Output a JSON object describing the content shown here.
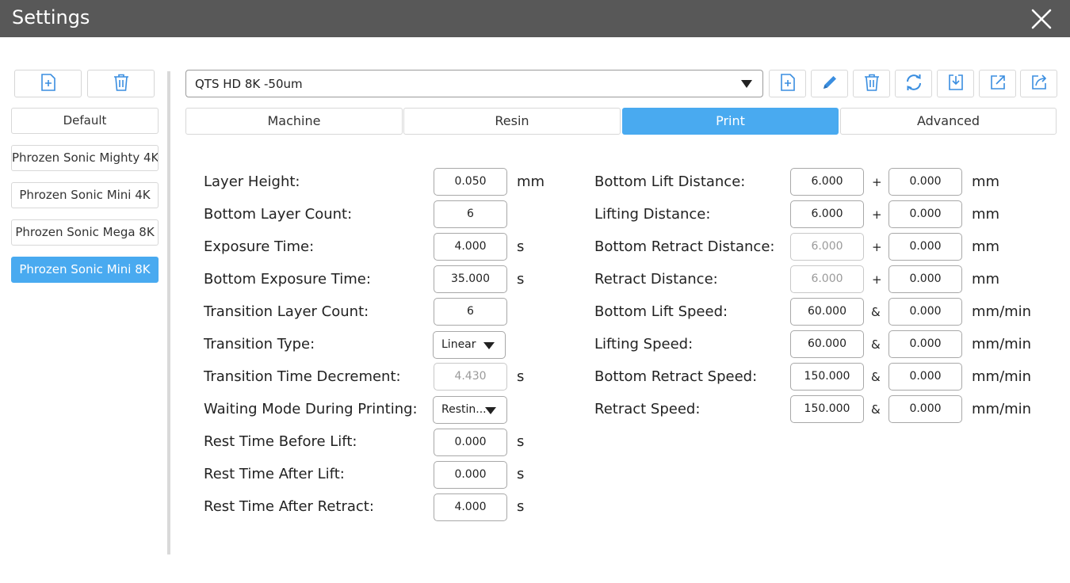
{
  "window": {
    "title": "Settings"
  },
  "colors": {
    "accent": "#49aaf0",
    "titlebar": "#585858",
    "icon": "#3a8ee0"
  },
  "profiles": {
    "items": [
      {
        "label": "Default"
      },
      {
        "label": "Phrozen Sonic Mighty 4K"
      },
      {
        "label": "Phrozen Sonic Mini 4K"
      },
      {
        "label": "Phrozen Sonic Mega 8K"
      },
      {
        "label": "Phrozen Sonic Mini 8K"
      }
    ],
    "selected": "Phrozen Sonic Mini 8K"
  },
  "preset": {
    "value": "QTS HD 8K -50um"
  },
  "tabs": [
    {
      "label": "Machine"
    },
    {
      "label": "Resin"
    },
    {
      "label": "Print"
    },
    {
      "label": "Advanced"
    }
  ],
  "active_tab": "Print",
  "left": {
    "rows": [
      {
        "label": "Layer Height:",
        "value": "0.050",
        "unit": "mm"
      },
      {
        "label": "Bottom Layer Count:",
        "value": "6",
        "unit": ""
      },
      {
        "label": "Exposure Time:",
        "value": "4.000",
        "unit": "s"
      },
      {
        "label": "Bottom Exposure Time:",
        "value": "35.000",
        "unit": "s"
      },
      {
        "label": "Transition Layer Count:",
        "value": "6",
        "unit": ""
      },
      {
        "label": "Transition Type:",
        "value": "Linear",
        "unit": ""
      },
      {
        "label": "Transition Time Decrement:",
        "value": "4.430",
        "unit": "s"
      },
      {
        "label": "Waiting Mode During Printing:",
        "value": "Restin...",
        "unit": ""
      },
      {
        "label": "Rest Time Before Lift:",
        "value": "0.000",
        "unit": "s"
      },
      {
        "label": "Rest Time After Lift:",
        "value": "0.000",
        "unit": "s"
      },
      {
        "label": "Rest Time After Retract:",
        "value": "4.000",
        "unit": "s"
      }
    ]
  },
  "right": {
    "rows": [
      {
        "label": "Bottom Lift Distance:",
        "value1": "6.000",
        "sep": "+",
        "value2": "0.000",
        "unit": "mm"
      },
      {
        "label": "Lifting Distance:",
        "value1": "6.000",
        "sep": "+",
        "value2": "0.000",
        "unit": "mm"
      },
      {
        "label": "Bottom Retract Distance:",
        "value1": "6.000",
        "sep": "+",
        "value2": "0.000",
        "unit": "mm"
      },
      {
        "label": "Retract Distance:",
        "value1": "6.000",
        "sep": "+",
        "value2": "0.000",
        "unit": "mm"
      },
      {
        "label": "Bottom Lift Speed:",
        "value1": "60.000",
        "sep": "&",
        "value2": "0.000",
        "unit": "mm/min"
      },
      {
        "label": "Lifting Speed:",
        "value1": "60.000",
        "sep": "&",
        "value2": "0.000",
        "unit": "mm/min"
      },
      {
        "label": "Bottom Retract Speed:",
        "value1": "150.000",
        "sep": "&",
        "value2": "0.000",
        "unit": "mm/min"
      },
      {
        "label": "Retract Speed:",
        "value1": "150.000",
        "sep": "&",
        "value2": "0.000",
        "unit": "mm/min"
      }
    ]
  }
}
